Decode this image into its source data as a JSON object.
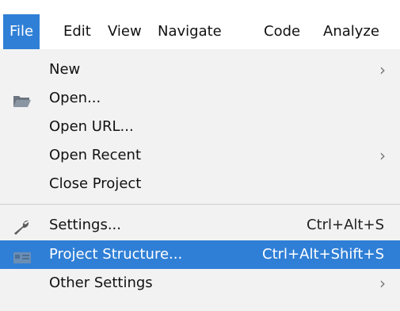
{
  "menubar": {
    "items": [
      {
        "label": "File",
        "mnemonic": "F"
      },
      {
        "label": "Edit",
        "mnemonic": "E"
      },
      {
        "label": "View",
        "mnemonic": "V"
      },
      {
        "label": "Navigate",
        "mnemonic": "N"
      },
      {
        "label": "Code",
        "mnemonic": "C"
      },
      {
        "label": "Analyze",
        "mnemonic": "z"
      }
    ]
  },
  "file_menu": {
    "items": [
      {
        "label": "New",
        "icon": "",
        "submenu": true
      },
      {
        "label": "Open...",
        "icon": "folder-icon"
      },
      {
        "label": "Open URL..."
      },
      {
        "label": "Open Recent",
        "submenu": true
      },
      {
        "label": "Close Project"
      },
      {
        "label": "Settings...",
        "icon": "wrench-icon",
        "shortcut": "Ctrl+Alt+S"
      },
      {
        "label": "Project Structure...",
        "icon": "project-structure-icon",
        "shortcut": "Ctrl+Alt+Shift+S",
        "selected": true
      },
      {
        "label": "Other Settings",
        "submenu": true
      }
    ]
  },
  "colors": {
    "accent": "#2f7fd6",
    "menu_bg": "#f2f2f2"
  }
}
